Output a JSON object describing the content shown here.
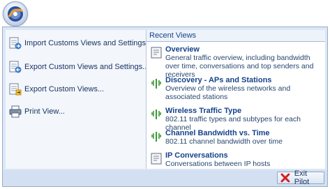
{
  "left_menu": [
    {
      "label": "Import Customs Views and Settings...",
      "icon": "import-views-icon"
    },
    {
      "label": "Export Custom Views and Settings...",
      "icon": "export-views-settings-icon"
    },
    {
      "label": "Export Custom Views...",
      "icon": "export-views-icon"
    },
    {
      "label": "Print View...",
      "icon": "printer-icon"
    }
  ],
  "recent_views": {
    "header": "Recent Views",
    "items": [
      {
        "title": "Overview",
        "description": "General traffic overview, including bandwidth over time, conversations and top senders and receivers",
        "icon": "document-icon"
      },
      {
        "title": "Discovery - APs and Stations",
        "description": "Overview of the wireless networks and associated stations",
        "icon": "wireless-icon"
      },
      {
        "title": "Wireless Traffic Type",
        "description": "802.11 traffic types and subtypes for each channel",
        "icon": "wireless-icon"
      },
      {
        "title": "Channel Bandwidth vs. Time",
        "description": "802.11 channel bandwidth over time",
        "icon": "wireless-icon"
      },
      {
        "title": "IP Conversations",
        "description": "Conversations between IP hosts",
        "icon": "document-icon"
      }
    ]
  },
  "exit_button": {
    "label": "Exit Pilot",
    "icon": "close-x-icon"
  },
  "colors": {
    "accent": "#15428b",
    "menu_bg": "#dce7f5",
    "exit_icon": "#d42020",
    "wireless_green": "#3a9a35"
  }
}
